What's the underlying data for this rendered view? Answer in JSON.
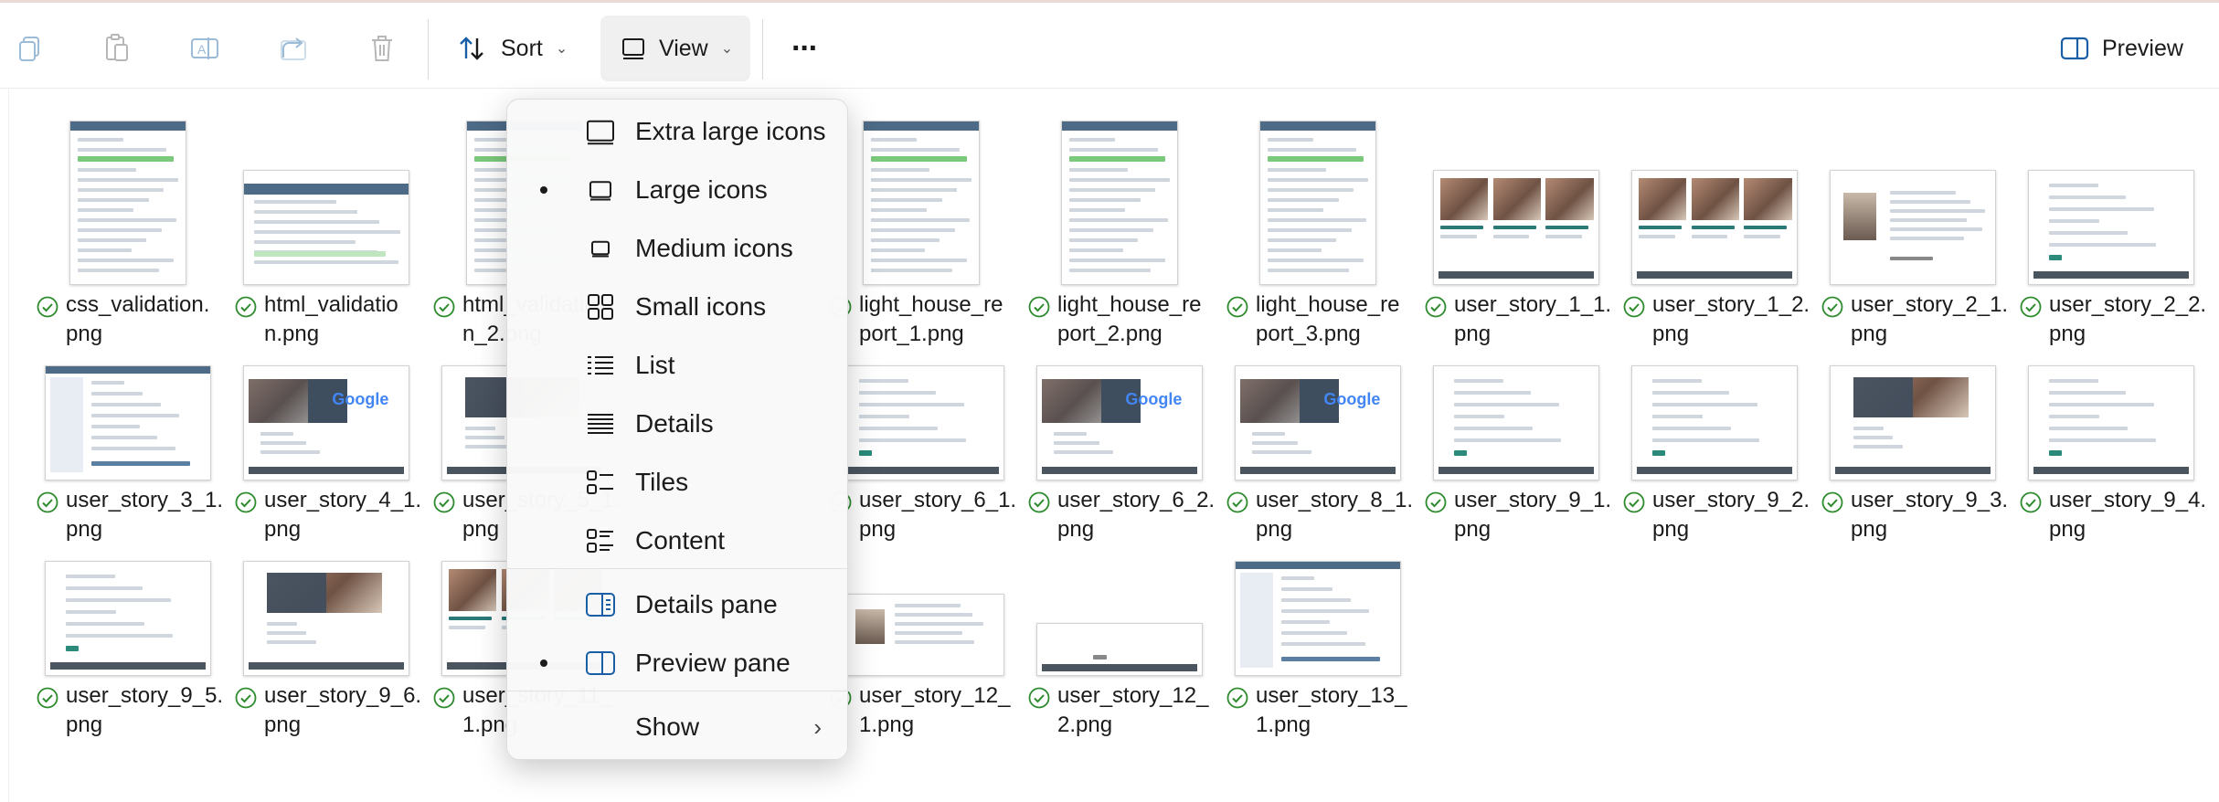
{
  "toolbar": {
    "sort_label": "Sort",
    "view_label": "View",
    "more_label": "···",
    "preview_label": "Preview"
  },
  "view_menu": {
    "items": [
      {
        "label": "Extra large icons",
        "icon": "monitor-icon",
        "selected": false
      },
      {
        "label": "Large icons",
        "icon": "monitor-icon",
        "selected": true
      },
      {
        "label": "Medium icons",
        "icon": "monitor-icon",
        "selected": false
      },
      {
        "label": "Small icons",
        "icon": "grid-icon",
        "selected": false
      },
      {
        "label": "List",
        "icon": "list-icon",
        "selected": false
      },
      {
        "label": "Details",
        "icon": "details-icon",
        "selected": false
      },
      {
        "label": "Tiles",
        "icon": "tiles-icon",
        "selected": false
      },
      {
        "label": "Content",
        "icon": "content-icon",
        "selected": false
      },
      {
        "label": "Details pane",
        "icon": "details-pane-icon",
        "selected": false
      },
      {
        "label": "Preview pane",
        "icon": "preview-pane-icon",
        "selected": true
      },
      {
        "label": "Show",
        "icon": "",
        "selected": false
      }
    ]
  },
  "files": [
    {
      "name": "css_validation.\npng",
      "thumb": "portrait-doc"
    },
    {
      "name": "html_validatio\nn.png",
      "thumb": "wide-doc"
    },
    {
      "name": "html_validatio\nn_2.png",
      "thumb": "portrait-doc"
    },
    {
      "name": "",
      "thumb": "hidden"
    },
    {
      "name": "light_house_re\nport_1.png",
      "thumb": "portrait-doc"
    },
    {
      "name": "light_house_re\nport_2.png",
      "thumb": "portrait-doc"
    },
    {
      "name": "light_house_re\nport_3.png",
      "thumb": "portrait-doc"
    },
    {
      "name": "user_story_1_1.\npng",
      "thumb": "wide-cards"
    },
    {
      "name": "user_story_1_2.\npng",
      "thumb": "wide-cards"
    },
    {
      "name": "user_story_2_1.\npng",
      "thumb": "wide-about"
    },
    {
      "name": "user_story_2_2.\npng",
      "thumb": "wide-form"
    },
    {
      "name": "user_story_3_1.\npng",
      "thumb": "wide-admin"
    },
    {
      "name": "user_story_4_1.\npng",
      "thumb": "wide-google"
    },
    {
      "name": "user_story_5_1.\npng",
      "thumb": "wide-hero"
    },
    {
      "name": "",
      "thumb": "hidden"
    },
    {
      "name": "user_story_6_1.\npng",
      "thumb": "wide-form"
    },
    {
      "name": "user_story_6_2.\npng",
      "thumb": "wide-google"
    },
    {
      "name": "user_story_8_1.\npng",
      "thumb": "wide-google"
    },
    {
      "name": "user_story_9_1.\npng",
      "thumb": "wide-form"
    },
    {
      "name": "user_story_9_2.\npng",
      "thumb": "wide-form"
    },
    {
      "name": "user_story_9_3.\npng",
      "thumb": "wide-hero"
    },
    {
      "name": "user_story_9_4.\npng",
      "thumb": "wide-form"
    },
    {
      "name": "user_story_9_5.\npng",
      "thumb": "wide-form"
    },
    {
      "name": "user_story_9_6.\npng",
      "thumb": "wide-hero"
    },
    {
      "name": "user_story_11_\n1.png",
      "thumb": "wide-cards"
    },
    {
      "name": "",
      "thumb": "hidden"
    },
    {
      "name": "user_story_12_\n1.png",
      "thumb": "short-about"
    },
    {
      "name": "user_story_12_\n2.png",
      "thumb": "short-form"
    },
    {
      "name": "user_story_13_\n1.png",
      "thumb": "wide-admin"
    }
  ]
}
